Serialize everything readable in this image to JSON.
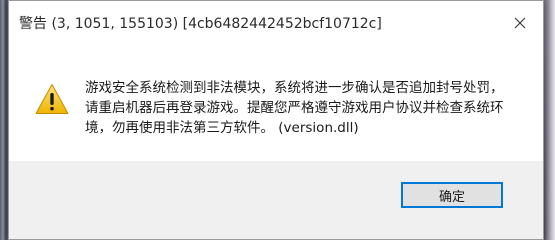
{
  "dialog": {
    "title": "警告 (3, 1051, 155103) [4cb6482442452bcf10712c]",
    "message": "游戏安全系统检测到非法模块，系统将进一步确认是否追加封号处罚，请重启机器后再登录游戏。提醒您严格遵守游戏用户协议并检查系统环境，勿再使用非法第三方软件。 (version.dll)",
    "ok_label": "确定",
    "icon": "warning-icon",
    "colors": {
      "accent": "#0078d7",
      "warning_yellow": "#f5c518",
      "footer_bg": "#f0f0f0"
    }
  }
}
